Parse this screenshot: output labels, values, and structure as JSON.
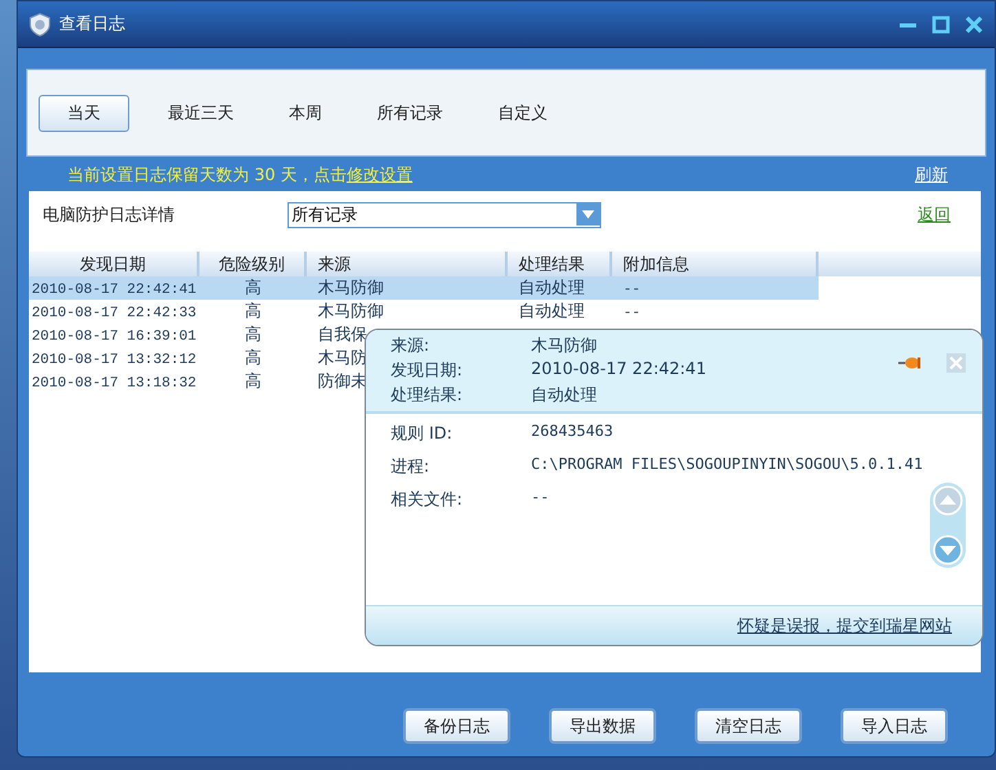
{
  "window": {
    "title": "查看日志"
  },
  "tabs": [
    {
      "label": "当天",
      "selected": true
    },
    {
      "label": "最近三天",
      "selected": false
    },
    {
      "label": "本周",
      "selected": false
    },
    {
      "label": "所有记录",
      "selected": false
    },
    {
      "label": "自定义",
      "selected": false
    }
  ],
  "retention_notice": {
    "text": "当前设置日志保留天数为 30 天，点击",
    "link": "修改设置"
  },
  "refresh_link": "刷新",
  "section_title": "电脑防护日志详情",
  "filter_dropdown": {
    "value": "所有记录"
  },
  "back_link": "返回",
  "table": {
    "columns": [
      "发现日期",
      "危险级别",
      "来源",
      "处理结果",
      "附加信息"
    ],
    "rows": [
      {
        "selected": true,
        "cells": [
          "2010-08-17 22:42:41",
          "高",
          "木马防御",
          "自动处理",
          "--"
        ]
      },
      {
        "selected": false,
        "cells": [
          "2010-08-17 22:42:33",
          "高",
          "木马防御",
          "自动处理",
          "--"
        ]
      },
      {
        "selected": false,
        "cells": [
          "2010-08-17 16:39:01",
          "高",
          "自我保"
        ]
      },
      {
        "selected": false,
        "cells": [
          "2010-08-17 13:32:12",
          "高",
          "木马防"
        ]
      },
      {
        "selected": false,
        "cells": [
          "2010-08-17 13:18:32",
          "高",
          "防御未"
        ]
      }
    ]
  },
  "detail_popup": {
    "summary": [
      {
        "label": "来源:",
        "value": "木马防御"
      },
      {
        "label": "发现日期:",
        "value": "2010-08-17 22:42:41"
      },
      {
        "label": "处理结果:",
        "value": "自动处理"
      }
    ],
    "details": [
      {
        "label": "规则 ID:",
        "value": "268435463"
      },
      {
        "label": "进程:",
        "value": "C:\\PROGRAM FILES\\SOGOUPINYIN\\SOGOU\\5.0.1.41"
      },
      {
        "label": "相关文件:",
        "value": "--"
      }
    ],
    "report_link": "怀疑是误报，提交到瑞星网站"
  },
  "buttons": [
    "备份日志",
    "导出数据",
    "清空日志",
    "导入日志"
  ]
}
